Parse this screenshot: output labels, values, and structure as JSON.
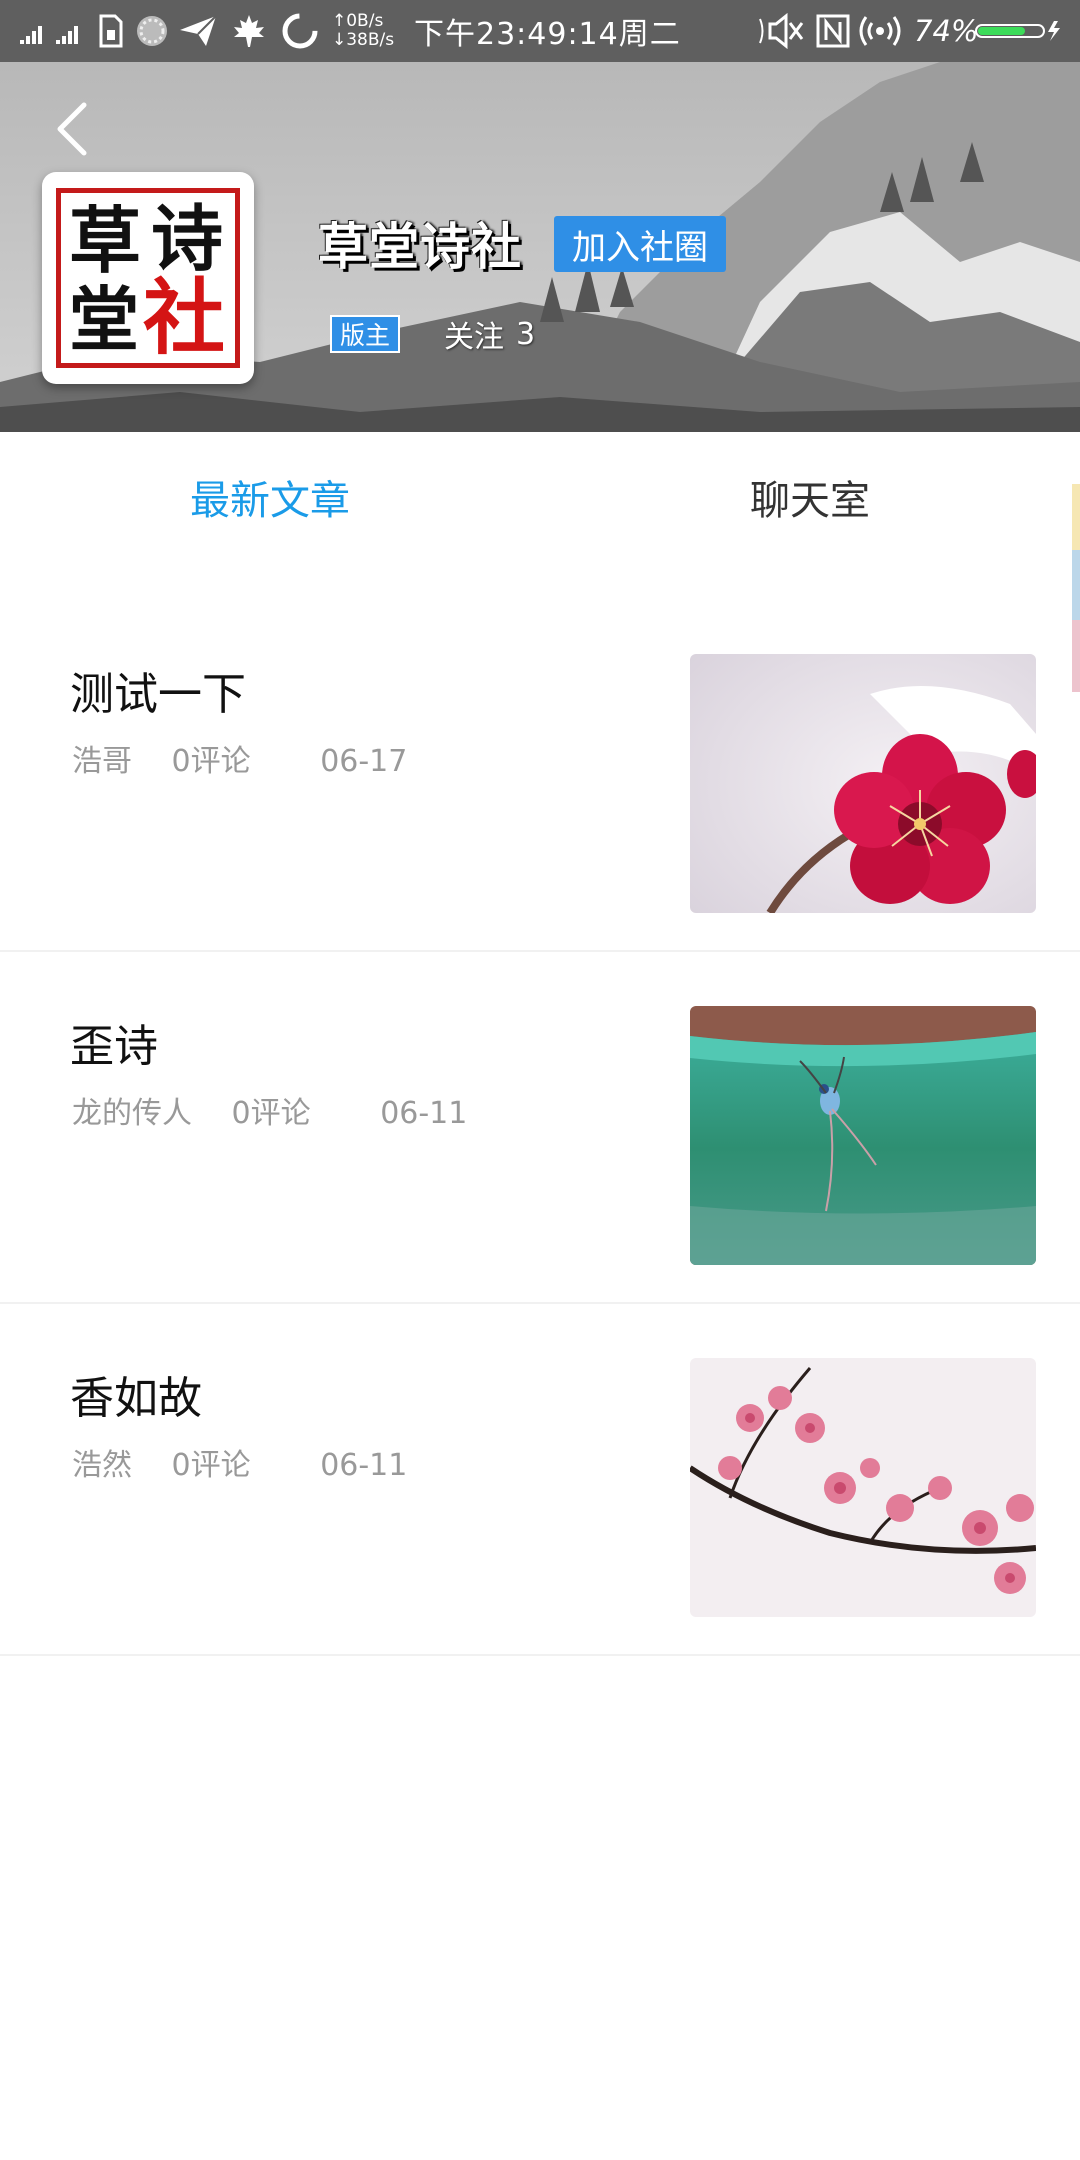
{
  "status_bar": {
    "net_up": "↑0B/s",
    "net_down": "↓38B/s",
    "time": "下午23:49:14周二",
    "battery_percent": "74%",
    "battery_level": 0.74
  },
  "header": {
    "community_name": "草堂诗社",
    "logo_chars": [
      "草",
      "诗",
      "堂",
      "社"
    ],
    "join_label": "加入社圈",
    "owner_badge": "版主",
    "follow_label": "关注",
    "follow_count": "3"
  },
  "tabs": [
    {
      "label": "最新文章",
      "active": true
    },
    {
      "label": "聊天室",
      "active": false
    }
  ],
  "articles": [
    {
      "title": "测试一下",
      "author": "浩哥",
      "comments": "0评论",
      "date": "06-17",
      "thumb": "red-plum-blossom"
    },
    {
      "title": "歪诗",
      "author": "龙的传人",
      "comments": "0评论",
      "date": "06-11",
      "thumb": "insect-on-green-pot"
    },
    {
      "title": "香如故",
      "author": "浩然",
      "comments": "0评论",
      "date": "06-11",
      "thumb": "pink-plum-branch"
    }
  ],
  "colors": {
    "accent": "#1a9be8",
    "button_blue": "#2f8fe6",
    "meta_gray": "#999999",
    "logo_red": "#c41a1a"
  }
}
